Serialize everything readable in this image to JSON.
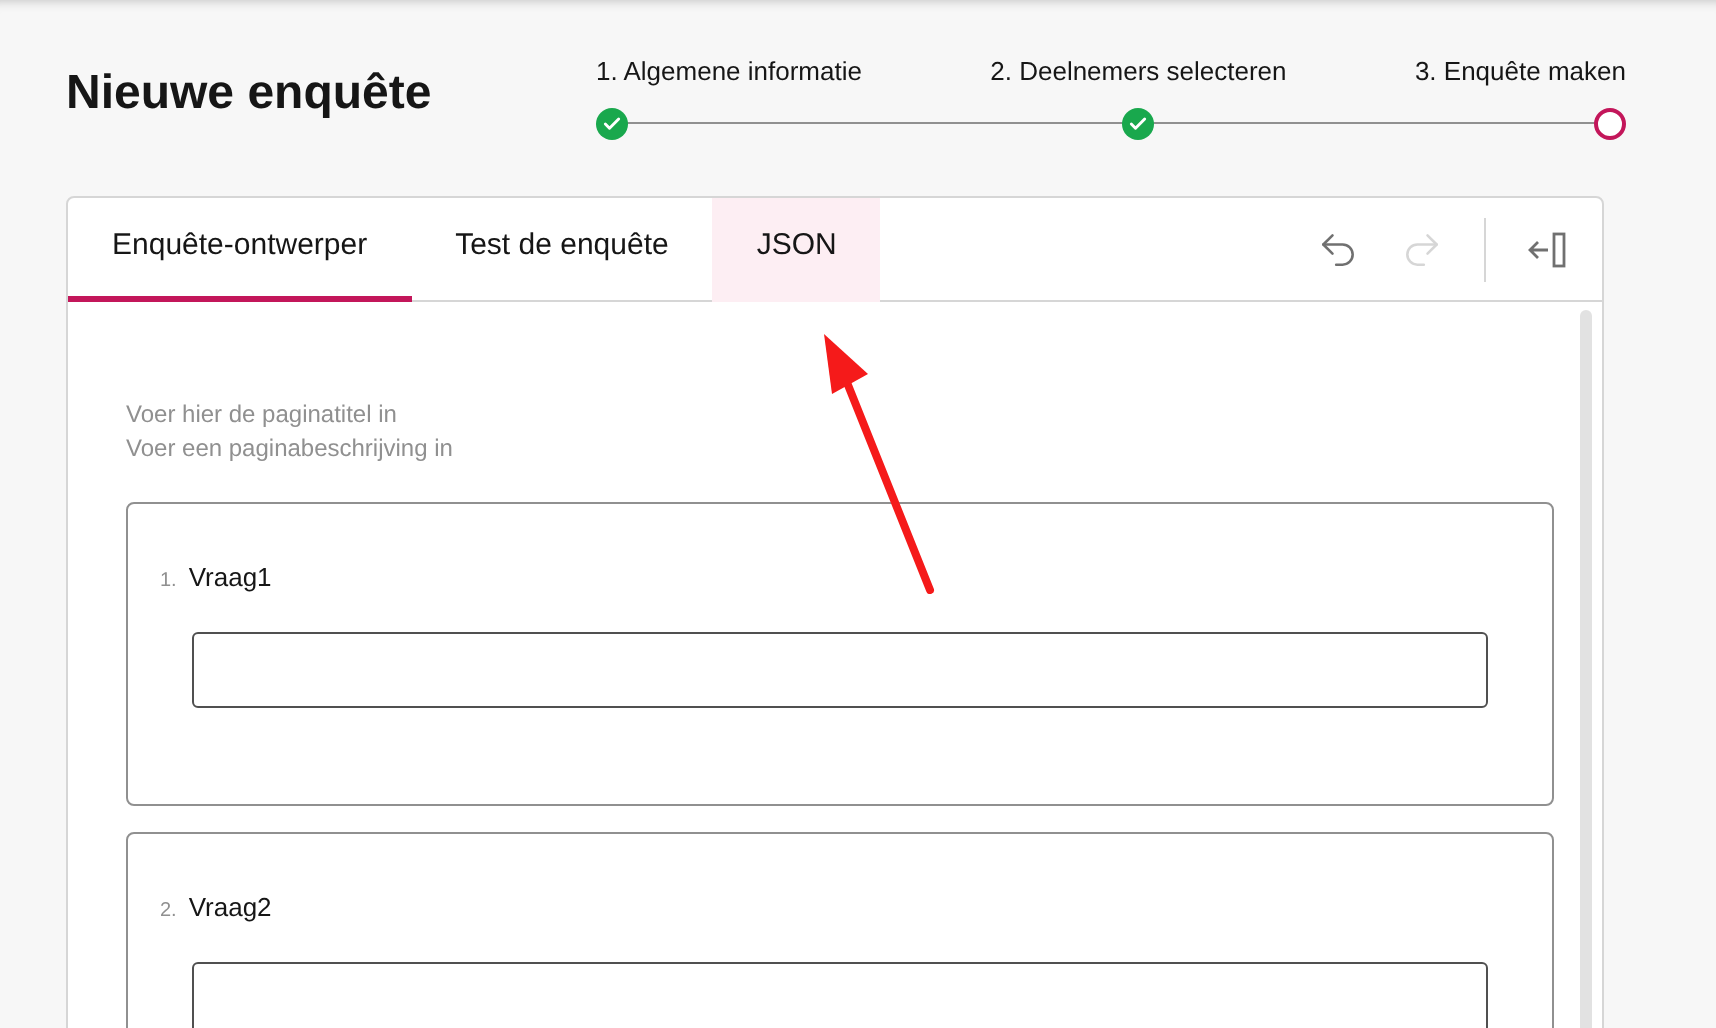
{
  "title": "Nieuwe enquête",
  "steps": [
    {
      "label": "1. Algemene informatie",
      "completed": true
    },
    {
      "label": "2. Deelnemers selecteren",
      "completed": true
    },
    {
      "label": "3. Enquête maken",
      "completed": false
    }
  ],
  "tabs": [
    {
      "label": "Enquête-ontwerper",
      "selected": true,
      "highlighted": false
    },
    {
      "label": "Test de enquête",
      "selected": false,
      "highlighted": false
    },
    {
      "label": "JSON",
      "selected": false,
      "highlighted": true
    }
  ],
  "toolbar": {
    "undo_disabled": false,
    "redo_disabled": true
  },
  "page": {
    "title_placeholder": "Voer hier de paginatitel in",
    "description_placeholder": "Voer een paginabeschrijving in"
  },
  "questions": [
    {
      "number": "1.",
      "title": "Vraag1"
    },
    {
      "number": "2.",
      "title": "Vraag2"
    }
  ]
}
